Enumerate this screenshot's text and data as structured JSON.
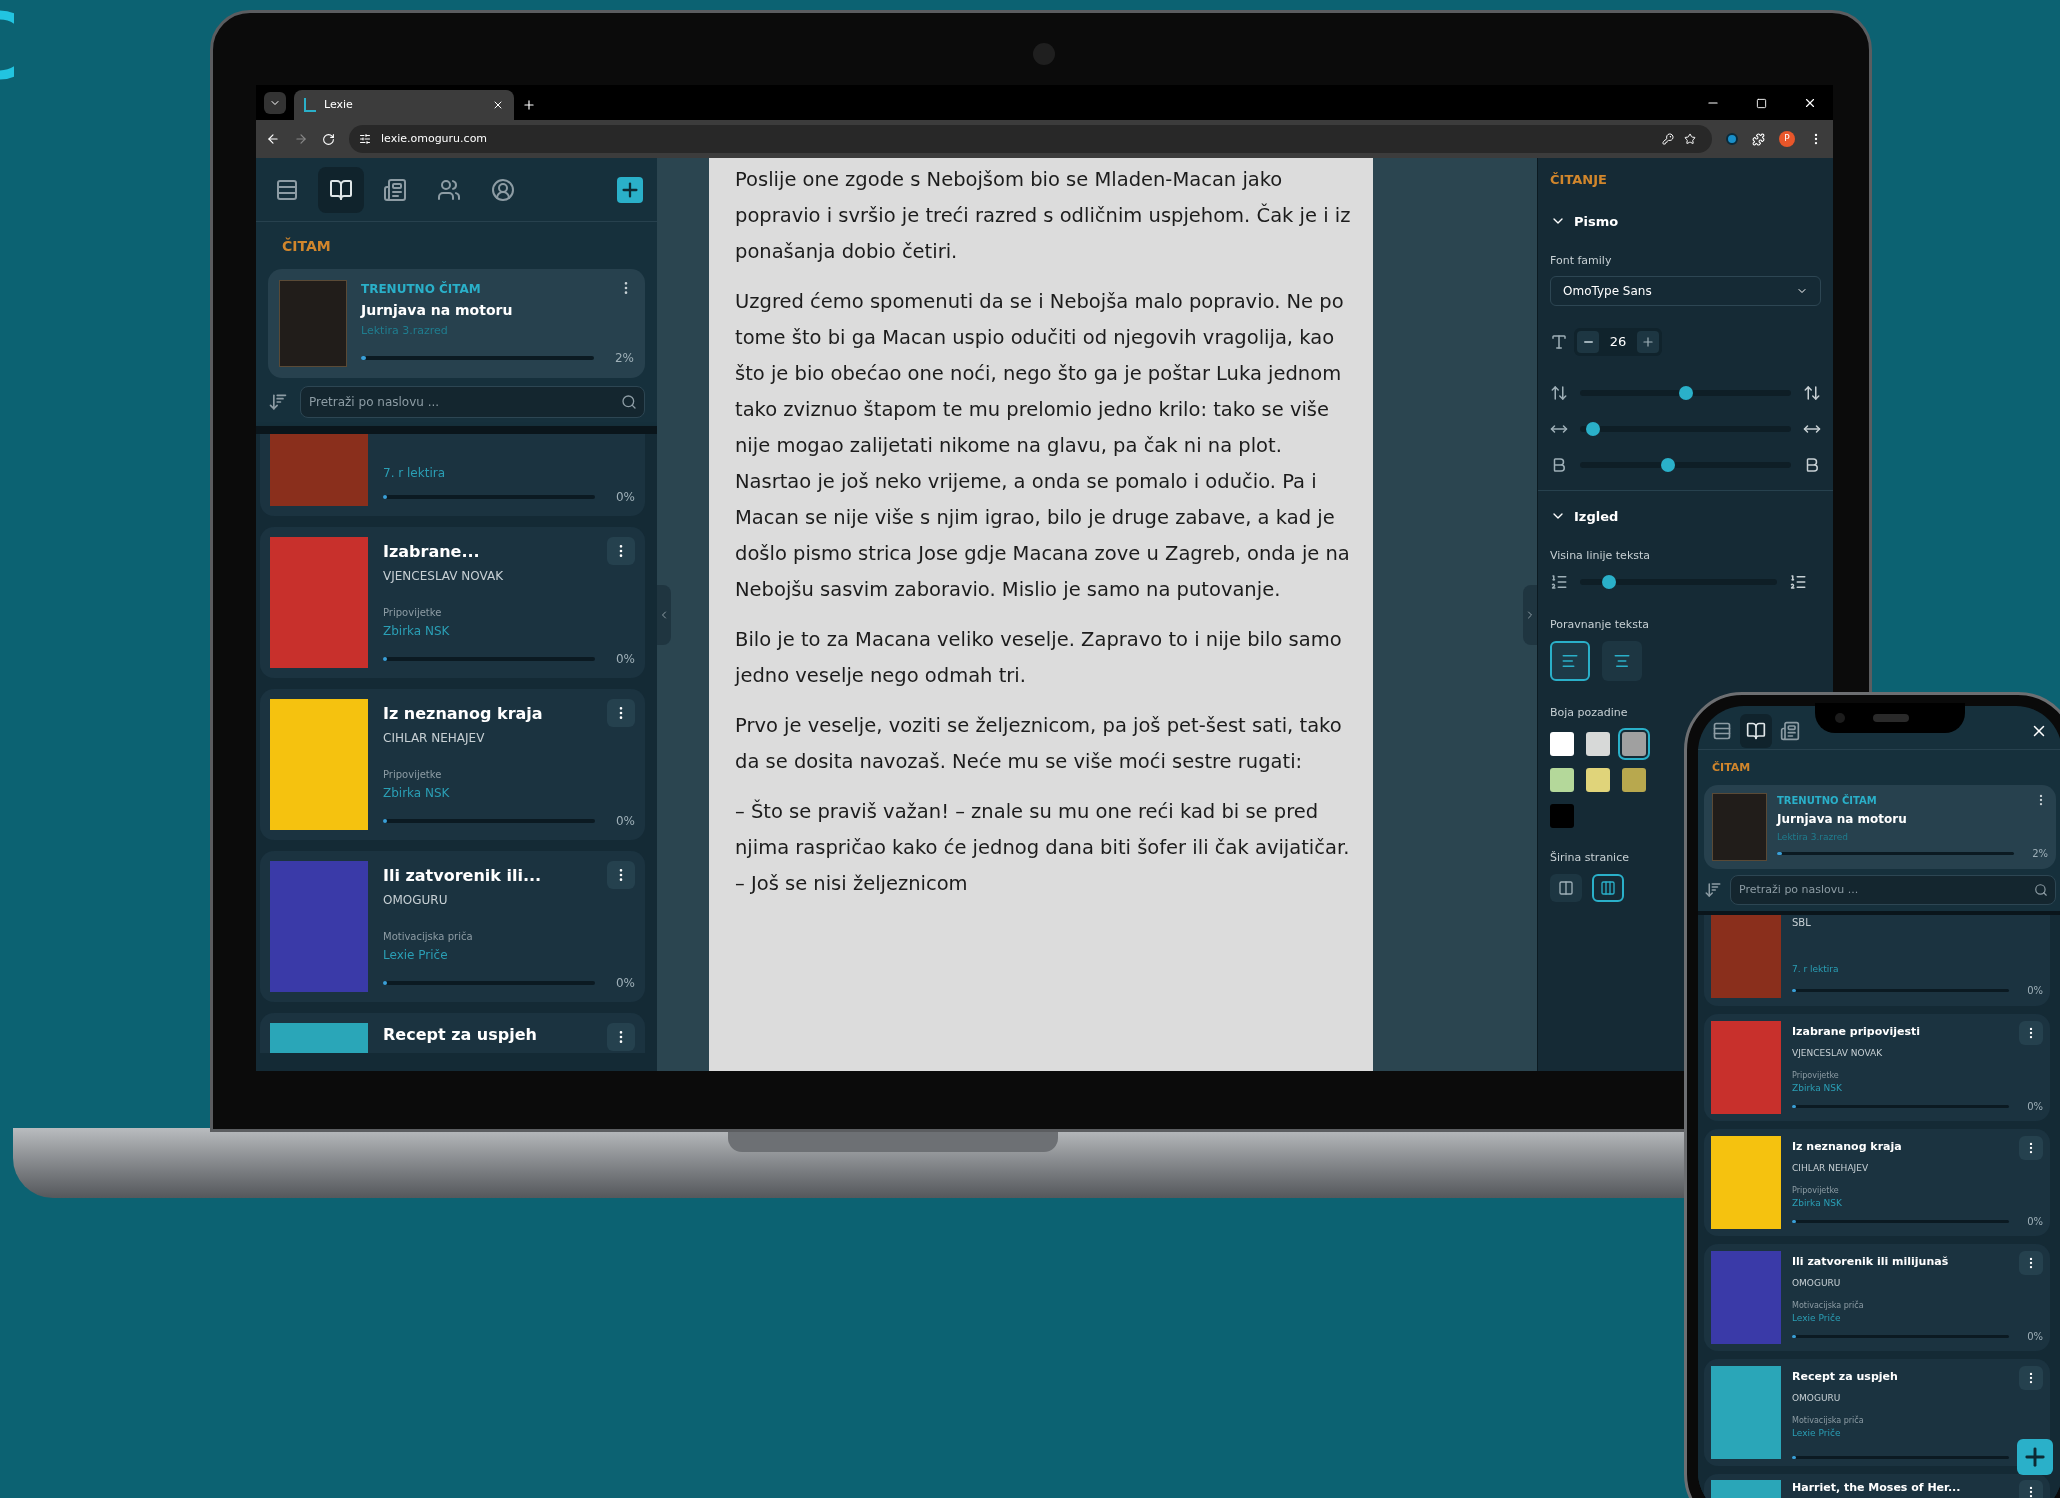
{
  "browser": {
    "tab_title": "Lexie",
    "url": "lexie.omoguru.com",
    "profile_initial": "P"
  },
  "sidebar": {
    "nav": [
      {
        "selected": false
      },
      {
        "selected": true
      },
      {
        "selected": false
      },
      {
        "selected": false
      },
      {
        "selected": false
      }
    ],
    "section_title": "ČITAM",
    "current": {
      "label": "TRENUTNO ČITAM",
      "title": "Jurnjava na motoru",
      "subtitle": "Lektira 3.razred",
      "level": 0.02,
      "percent": "2%"
    },
    "search": {
      "placeholder": "Pretraži po naslovu ..."
    },
    "books": [
      {
        "kind": "partial_top",
        "color": "#8a2f1c",
        "collection": "7. r lektira",
        "percent": "0%",
        "level": 0
      },
      {
        "kind": "full",
        "color": "#c8302c",
        "title": "Izabrane...",
        "author": "VJENCESLAV NOVAK",
        "genre": "Pripovijetke",
        "collection": "Zbirka NSK",
        "percent": "0%",
        "level": 0
      },
      {
        "kind": "full",
        "color": "#f5c20f",
        "title": "Iz neznanog kraja",
        "author": "CIHLAR NEHAJEV",
        "genre": "Pripovijetke",
        "collection": "Zbirka NSK",
        "percent": "0%",
        "level": 0
      },
      {
        "kind": "full",
        "color": "#3a3aa8",
        "title": "Ili zatvorenik ili...",
        "author": "OMOGURU",
        "genre": "Motivacijska priča",
        "collection": "Lexie Priče",
        "percent": "0%",
        "level": 0
      },
      {
        "kind": "partial_bottom",
        "color": "#2aa6b8",
        "title": "Recept za uspjeh"
      }
    ]
  },
  "reader": {
    "paragraphs": [
      "Poslije one zgode s Nebojšom bio se Mladen-Macan jako popravio i svršio je treći razred s odličnim uspjehom. Čak je i iz ponašanja dobio četiri.",
      "Uzgred ćemo spomenuti da se i Nebojša malo popravio. Ne po tome što bi ga Macan uspio odučiti od njegovih vragolija, kao što je bio obećao one noći, nego što ga je poštar Luka jednom tako zviznuo štapom te mu prelomio jedno krilo: tako se više nije mogao zalijetati nikome na glavu, pa čak ni na plot. Nasrtao je još neko vrijeme, a onda se pomalo i odučio. Pa i Macan se nije više s njim igrao, bilo je druge zabave, a kad je došlo pismo strica Jose gdje Macana zove u Zagreb, onda je na Nebojšu sasvim zaboravio. Mislio je samo na putovanje.",
      "Bilo je to za Macana veliko veselje. Zapravo to i nije bilo samo jedno veselje nego odmah tri.",
      "Prvo je veselje, voziti se željeznicom, pa još pet-šest sati, tako da se dosita navozaš. Neće mu se više moći sestre rugati:",
      "– Što se praviš važan! – znale su mu one reći kad bi se pred njima raspričao kako će jednog dana biti šofer ili čak avijatičar. – Još se nisi željeznicom"
    ]
  },
  "settings": {
    "title": "ČITANJE",
    "pismo": {
      "title": "Pismo",
      "expanded": true
    },
    "font_family_label": "Font family",
    "font_family": "OmoType Sans",
    "font_size": "26",
    "font_sliders": [
      {
        "level": 0.5
      },
      {
        "level": 0.03
      },
      {
        "level": 0.41
      }
    ],
    "izgled": {
      "title": "Izgled",
      "expanded": true
    },
    "line_height_label": "Visina linije teksta",
    "line_height": {
      "level": 0.12
    },
    "align_label": "Poravnanje teksta",
    "align": [
      {
        "selected": true
      },
      {
        "selected": false
      }
    ],
    "background_label": "Boja pozadine",
    "backgrounds": [
      {
        "color": "#ffffff",
        "selected": false
      },
      {
        "color": "#d7d9d8",
        "selected": false
      },
      {
        "color": "#a0a0a0",
        "selected": true
      },
      {
        "color": "#b4d89a",
        "selected": false
      },
      {
        "color": "#e0d47a",
        "selected": false
      },
      {
        "color": "#b8a84e",
        "selected": false
      },
      {
        "color": "#000000",
        "selected": false
      }
    ],
    "width_label": "Širina stranice",
    "widths": [
      {
        "selected": false
      },
      {
        "selected": true
      }
    ]
  },
  "phone": {
    "nav": [
      {
        "selected": false
      },
      {
        "selected": true
      },
      {
        "selected": false
      }
    ],
    "section_title": "ČITAM",
    "current": {
      "label": "TRENUTNO ČITAM",
      "title": "Jurnjava na motoru",
      "subtitle": "Lektira 3.razred",
      "level": 0.02,
      "percent": "2%"
    },
    "search": {
      "placeholder": "Pretraži po naslovu ..."
    },
    "books": [
      {
        "kind": "partial_top",
        "color": "#8a2f1c",
        "author": "SBL",
        "collection": "7. r lektira",
        "percent": "0%",
        "level": 0
      },
      {
        "kind": "full",
        "color": "#c8302c",
        "title": "Izabrane pripovijesti",
        "author": "VJENCESLAV NOVAK",
        "genre": "Pripovijetke",
        "collection": "Zbirka NSK",
        "percent": "0%",
        "level": 0
      },
      {
        "kind": "full",
        "color": "#f5c20f",
        "title": "Iz neznanog kraja",
        "author": "CIHLAR NEHAJEV",
        "genre": "Pripovijetke",
        "collection": "Zbirka NSK",
        "percent": "0%",
        "level": 0
      },
      {
        "kind": "full",
        "color": "#3a3aa8",
        "title": "Ili zatvorenik ili milijunaš",
        "author": "OMOGURU",
        "genre": "Motivacijska priča",
        "collection": "Lexie Priče",
        "percent": "0%",
        "level": 0
      },
      {
        "kind": "full",
        "color": "#2aa6b8",
        "title": "Recept za uspjeh",
        "author": "OMOGURU",
        "genre": "Motivacijska priča",
        "collection": "Lexie Priče",
        "level": 0
      },
      {
        "kind": "partial_bottom",
        "color": "#2aa6b8",
        "title": "Harriet, the Moses of Her..."
      }
    ]
  }
}
